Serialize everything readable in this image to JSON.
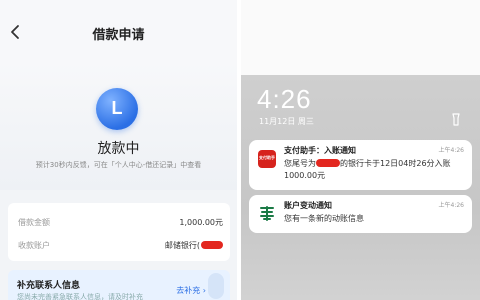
{
  "loan_app": {
    "header": {
      "title": "借款申请"
    },
    "status": {
      "logo_letter": "L",
      "title": "放款中",
      "hint": "预计30秒内反馈，可在「个人中心-借还记录」中查看"
    },
    "details": [
      {
        "label": "借款金额",
        "value": "1,000.00元"
      },
      {
        "label": "收款账户",
        "value": "邮储银行("
      }
    ],
    "supplement": {
      "title": "补充联系人信息",
      "subtitle": "您尚未完善紧急联系人信息，请及时补充",
      "button": "去补充 ›"
    }
  },
  "lock_screen": {
    "time": "4:26",
    "date": "11月12日 周三",
    "notifications": [
      {
        "app_icon_text": "支付助手",
        "title": "支付助手：入账通知",
        "time": "上午4:26",
        "body_prefix": "您尾号为",
        "body_suffix": "的银行卡于12日04时26分入账1000.00元"
      },
      {
        "title": "账户变动通知",
        "time": "上午4:26",
        "body": "您有一条新的动账信息"
      }
    ]
  },
  "colors": {
    "accent_blue": "#2b6fe5",
    "redaction_red": "#e3271f",
    "bank_green": "#1a7a45"
  }
}
